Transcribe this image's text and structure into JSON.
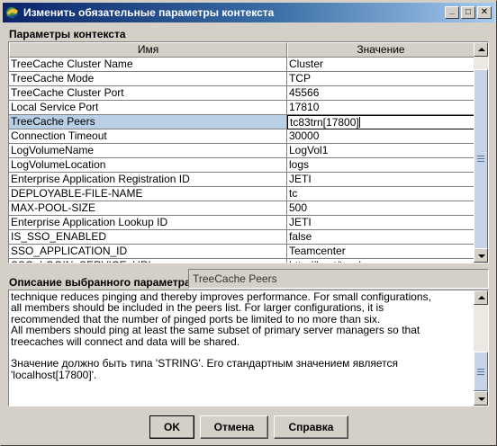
{
  "window": {
    "title": "Изменить обязательные параметры контекста",
    "minimize": "_",
    "maximize": "□",
    "close": "✕"
  },
  "context": {
    "section_label": "Параметры контекста",
    "columns": [
      "Имя",
      "Значение"
    ],
    "rows": [
      {
        "name": "TreeCache Cluster Name",
        "value": "Cluster"
      },
      {
        "name": "TreeCache Mode",
        "value": "TCP"
      },
      {
        "name": "TreeCache Cluster Port",
        "value": "45566"
      },
      {
        "name": "Local Service Port",
        "value": "17810"
      },
      {
        "name": "TreeCache Peers",
        "value": "tc83trn[17800]"
      },
      {
        "name": "Connection Timeout",
        "value": "30000"
      },
      {
        "name": "LogVolumeName",
        "value": "LogVol1"
      },
      {
        "name": "LogVolumeLocation",
        "value": "logs"
      },
      {
        "name": "Enterprise Application Registration ID",
        "value": "JETI"
      },
      {
        "name": "DEPLOYABLE-FILE-NAME",
        "value": "tc"
      },
      {
        "name": "MAX-POOL-SIZE",
        "value": "500"
      },
      {
        "name": "Enterprise Application Lookup ID",
        "value": "JETI"
      },
      {
        "name": "IS_SSO_ENABLED",
        "value": "false"
      },
      {
        "name": "SSO_APPLICATION_ID",
        "value": "Teamcenter"
      },
      {
        "name": "SSO_LOGIN_SERVICE_URL",
        "value": "http://host/tccsle"
      }
    ],
    "selected_index": 4
  },
  "description": {
    "label": "Описание выбранного параметра:",
    "selected_name": "TreeCache Peers",
    "lines": [
      "technique reduces pinging and thereby improves performance.  For small configurations,",
      "all members should be included in the peers list.  For larger configurations, it is",
      "recommended that the number of pinged ports be limited to no more than six.",
      "All members should ping at least the same subset of primary server managers so that",
      "treecaches will connect and data will be shared.",
      "",
      "  Значение должно быть типа 'STRING'.  Его стандартным значением является",
      "'localhost[17800]'."
    ]
  },
  "buttons": {
    "ok": "OK",
    "cancel": "Отмена",
    "help": "Справка"
  }
}
